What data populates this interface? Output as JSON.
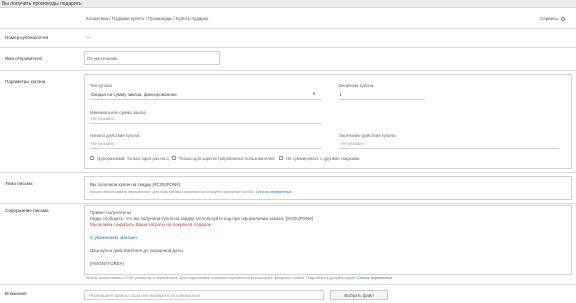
{
  "window": {
    "title": "Вы получить промокоды подарить"
  },
  "header": {
    "breadcrumb": "Косметика / Подарки купить / Промокоды / Купить подарок",
    "settings_label": "Сервисы"
  },
  "fields": {
    "number_label": "Номер купона/сетей",
    "number_value": "—",
    "sender_label": "Имя отправителя",
    "sender_value": "По умолчанию",
    "params_label": "Параметры купона",
    "type_label": "Тип купона",
    "type_value": "Скидка на сумму заказа, фиксированная",
    "value_label": "Величина купона",
    "value_value": "1",
    "min_sum_label": "Минимальная сумма заказа",
    "min_sum_value": "Не указано",
    "date_from_label": "Начало действия купона",
    "date_from_value": "Не указано",
    "date_to_label": "Окончание действия купона",
    "date_to_value": "Не указано",
    "checkbox1_label": "Одноразовый. Только один раз на одного пользователя",
    "checkbox2_label": "Только для зарегистрированных пользователей (без учета гостей)",
    "checkbox3_label": "Не суммировать с другими скидками",
    "subject_label": "Тема письма",
    "subject_value": "Вы получили купон на скидку {#COUPON#}",
    "subject_hint": "Можно использовать переменные. Для подстановки значения используйте фигурные скобки.",
    "subject_hint_link": "Список переменных",
    "body_label": "Содержание письма",
    "body_lines": [
      "Привет получатель!",
      "Рады сообщить, что вы получили купон на скидку. Используйте код при оформлении заказа: {#COUPON#}",
      "Мы можем сократить Ваши затраты на покупки в подарок.",
      "С уважением, магазин",
      "Ваш купон действителен до указанной даты.",
      "{#SIGNATURE#}"
    ],
    "body_hint": "Можно использовать HTML-разметку и переменные. Для подстановки значения переменной используйте фигурные скобки. Подробнее в документации.",
    "body_hint_link": "Список переменных",
    "attach_label": "Вложения",
    "attach_placeholder": "Перетащите файлы сюда или выберите на компьютере",
    "attach_button": "Выбрать файл"
  },
  "colors": {
    "accent": "#1a73c9",
    "border": "#d2d2d2",
    "warn_text": "#cc3333"
  }
}
